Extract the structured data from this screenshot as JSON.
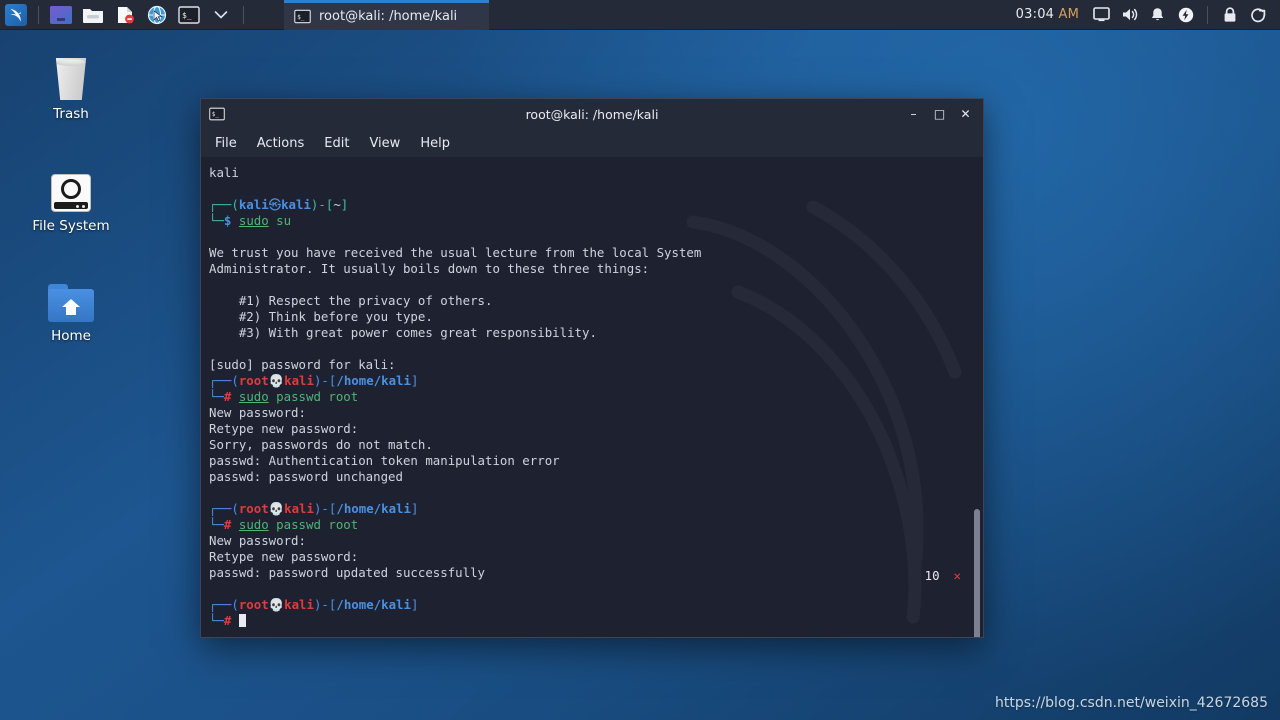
{
  "taskbar": {
    "launchers": [
      {
        "name": "kali-menu-icon",
        "label": "Kali Menu"
      },
      {
        "name": "workspace-switcher-icon",
        "label": "Workspace Switcher"
      },
      {
        "name": "file-manager-icon",
        "label": "File Manager"
      },
      {
        "name": "text-editor-icon",
        "label": "Text Editor"
      },
      {
        "name": "web-browser-icon",
        "label": "Web Browser"
      },
      {
        "name": "terminal-icon",
        "label": "Terminal"
      },
      {
        "name": "chevron-down-icon",
        "label": "More Applications"
      }
    ],
    "window_button": {
      "label": "root@kali: /home/kali",
      "icon": "terminal-icon",
      "active": true
    },
    "clock": {
      "time": "03:04",
      "ampm": "AM"
    },
    "tray": [
      {
        "name": "display-icon",
        "label": "Display"
      },
      {
        "name": "volume-icon",
        "label": "Volume"
      },
      {
        "name": "notification-bell-icon",
        "label": "Notifications"
      },
      {
        "name": "power-icon",
        "label": "Power Manager"
      },
      {
        "name": "lock-icon",
        "label": "Lock Screen"
      },
      {
        "name": "logout-icon",
        "label": "Log Out"
      }
    ]
  },
  "desktop": {
    "icons": [
      {
        "label": "Trash",
        "icon": "trash-icon"
      },
      {
        "label": "File System",
        "icon": "hard-drive-icon"
      },
      {
        "label": "Home",
        "icon": "home-folder-icon"
      }
    ],
    "watermark": "https://blog.csdn.net/weixin_42672685"
  },
  "terminal": {
    "title": "root@kali: /home/kali",
    "menu": [
      "File",
      "Actions",
      "Edit",
      "View",
      "Help"
    ],
    "window_controls": {
      "minimize": "–",
      "maximize": "□",
      "close": "✕"
    },
    "exit_status": {
      "code": "10",
      "marker": "✕"
    },
    "lines": {
      "l01": "kali",
      "prompt1_user": "kali",
      "prompt1_host": "kali",
      "prompt1_path": "~",
      "prompt1_sigil": "$",
      "cmd1_sudo": "sudo",
      "cmd1_rest": " su",
      "lecture1": "We trust you have received the usual lecture from the local System",
      "lecture2": "Administrator. It usually boils down to these three things:",
      "rule1": "    #1) Respect the privacy of others.",
      "rule2": "    #2) Think before you type.",
      "rule3": "    #3) With great power comes great responsibility.",
      "sudo_prompt": "[sudo] password for kali:",
      "prompt2_user": "root",
      "prompt2_host": "kali",
      "prompt2_path": "/home/kali",
      "prompt2_sigil": "#",
      "cmd2_sudo": "sudo",
      "cmd2_rest": " passwd root",
      "new_password": "New password:",
      "retype_password": "Retype new password:",
      "mismatch": "Sorry, passwords do not match.",
      "auth_error": "passwd: Authentication token manipulation error",
      "unchanged": "passwd: password unchanged",
      "prompt3_user": "root",
      "prompt3_host": "kali",
      "prompt3_path": "/home/kali",
      "prompt3_sigil": "#",
      "cmd3_sudo": "sudo",
      "cmd3_rest": " passwd root",
      "new_password2": "New password:",
      "retype_password2": "Retype new password:",
      "success": "passwd: password updated successfully",
      "prompt4_user": "root",
      "prompt4_host": "kali",
      "prompt4_path": "/home/kali",
      "prompt4_sigil": "#"
    }
  },
  "colors": {
    "accent_blue": "#4a90e2",
    "prompt_teal": "#3fb9a6",
    "error_red": "#e23b3b",
    "cmd_green": "#4fb477",
    "terminal_bg": "#1e2230",
    "panel_bg": "#252a38"
  }
}
